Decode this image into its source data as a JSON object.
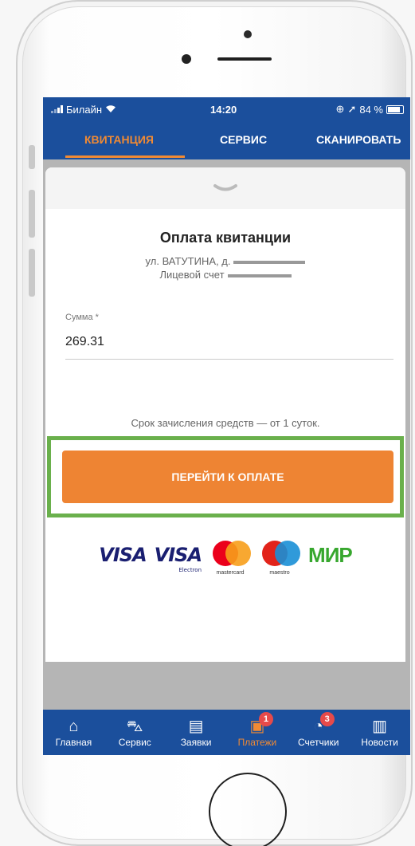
{
  "statusbar": {
    "carrier": "Билайн",
    "time": "14:20",
    "battery": "84 %"
  },
  "tabs": [
    {
      "label": "КВИТАНЦИЯ",
      "active": true
    },
    {
      "label": "СЕРВИС",
      "active": false
    },
    {
      "label": "СКАНИРОВАТЬ",
      "active": false
    }
  ],
  "sheet": {
    "title": "Оплата квитанции",
    "address": "ул. ВАТУТИНА, д.",
    "account": "Лицевой счет",
    "amount_label": "Сумма *",
    "amount_value": "269.31",
    "note": "Срок зачисления средств — от 1 суток.",
    "pay_button": "ПЕРЕЙТИ К ОПЛАТЕ"
  },
  "payment_logos": {
    "visa": "VISA",
    "visa_electron": "VISA",
    "visa_electron_sub": "Electron",
    "mastercard_sub": "mastercard",
    "maestro_sub": "maestro",
    "mir": "МИР"
  },
  "nav": [
    {
      "label": "Главная",
      "icon": "home-icon",
      "glyph": "⌂",
      "active": false,
      "badge": ""
    },
    {
      "label": "Сервис",
      "icon": "basket-icon",
      "glyph": "⌂",
      "active": false,
      "badge": ""
    },
    {
      "label": "Заявки",
      "icon": "requests-icon",
      "glyph": "▤",
      "active": false,
      "badge": ""
    },
    {
      "label": "Платежи",
      "icon": "payments-icon",
      "glyph": "▣",
      "active": true,
      "badge": "1"
    },
    {
      "label": "Счетчики",
      "icon": "meters-icon",
      "glyph": "◔",
      "active": false,
      "badge": "3"
    },
    {
      "label": "Новости",
      "icon": "news-icon",
      "glyph": "▥",
      "active": false,
      "badge": ""
    }
  ],
  "colors": {
    "brand": "#1b4f9c",
    "accent": "#ee8433",
    "highlight": "#6ab04c"
  }
}
